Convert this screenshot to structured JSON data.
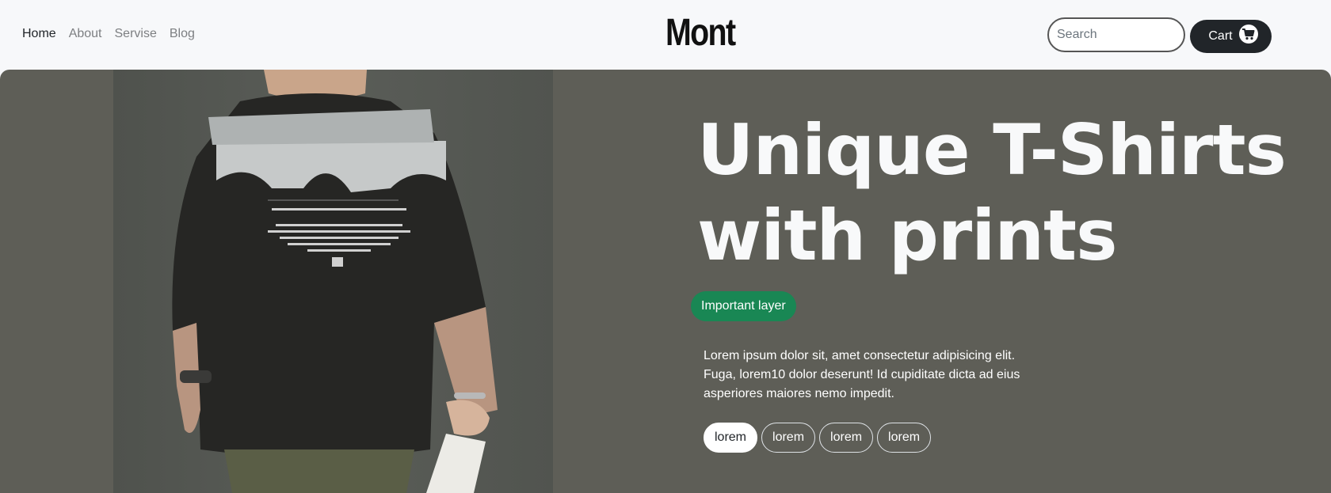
{
  "nav": {
    "links": [
      "Home",
      "About",
      "Servise",
      "Blog"
    ],
    "active_index": 0
  },
  "brand": "Mont",
  "search": {
    "placeholder": "Search",
    "value": ""
  },
  "cart": {
    "label": "Cart",
    "icon": "cart-icon"
  },
  "hero": {
    "title_line1": "Unique T-Shirts",
    "title_line2": "with prints",
    "badge": "Important layer",
    "text": "Lorem ipsum dolor sit, amet consectetur adipisicing elit. Fuga, lorem10 dolor deserunt! Id cupiditate dicta ad eius asperiores maiores nemo impedit.",
    "chips": [
      "lorem",
      "lorem",
      "lorem",
      "lorem"
    ],
    "active_chip": 0,
    "image": "person-back-black-tshirt-photo"
  },
  "colors": {
    "hero_bg": "#5e5e57",
    "badge": "#198754",
    "dark": "#212529",
    "nav_bg": "#f7f8fa"
  }
}
